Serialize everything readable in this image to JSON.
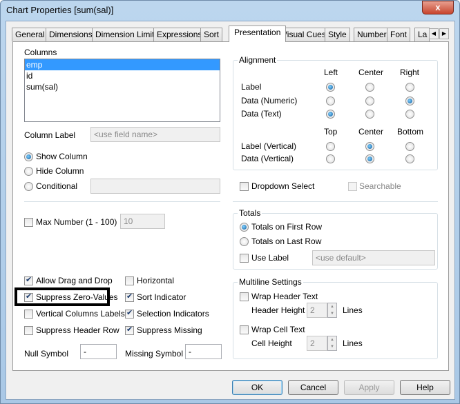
{
  "window": {
    "title": "Chart Properties [sum(sal)]",
    "close": "x"
  },
  "tabs": [
    {
      "label": "General"
    },
    {
      "label": "Dimensions"
    },
    {
      "label": "Dimension Limits"
    },
    {
      "label": "Expressions"
    },
    {
      "label": "Sort"
    },
    {
      "label": "Presentation",
      "selected": true
    },
    {
      "label": "Visual Cues"
    },
    {
      "label": "Style"
    },
    {
      "label": "Number"
    },
    {
      "label": "Font"
    },
    {
      "label": "La"
    }
  ],
  "columns": {
    "caption": "Columns",
    "items": [
      "emp",
      "id",
      "sum(sal)"
    ],
    "selected": "emp",
    "column_label": "Column Label",
    "column_label_placeholder": "<use field name>",
    "show": "Show Column",
    "hide": "Hide Column",
    "conditional": "Conditional",
    "visibility": "show"
  },
  "alignment": {
    "caption": "Alignment",
    "h_headers": [
      "Left",
      "Center",
      "Right"
    ],
    "v_headers": [
      "Top",
      "Center",
      "Bottom"
    ],
    "rows": [
      {
        "label": "Label",
        "value": 0
      },
      {
        "label": "Data (Numeric)",
        "value": 2
      },
      {
        "label": "Data (Text)",
        "value": 0
      }
    ],
    "vrows": [
      {
        "label": "Label (Vertical)",
        "value": 1
      },
      {
        "label": "Data (Vertical)",
        "value": 1
      }
    ]
  },
  "dropdown_select": {
    "label": "Dropdown Select",
    "checked": false
  },
  "searchable": {
    "label": "Searchable",
    "checked": false,
    "disabled": true
  },
  "max_number": {
    "label": "Max Number (1 - 100)",
    "checked": false,
    "value": "10"
  },
  "totals": {
    "caption": "Totals",
    "first": "Totals on First Row",
    "last": "Totals on Last Row",
    "selected": "first",
    "use_label": "Use Label",
    "use_label_checked": false,
    "placeholder": "<use default>"
  },
  "options": [
    {
      "label": "Allow Drag and Drop",
      "checked": true
    },
    {
      "label": "Horizontal",
      "checked": false
    },
    {
      "label": "Suppress Zero-Values",
      "checked": true
    },
    {
      "label": "Sort Indicator",
      "checked": true
    },
    {
      "label": "Vertical Columns Labels",
      "checked": false
    },
    {
      "label": "Selection Indicators",
      "checked": true
    },
    {
      "label": "Suppress Header Row",
      "checked": false
    },
    {
      "label": "Suppress Missing",
      "checked": true
    }
  ],
  "null_symbol": {
    "label": "Null Symbol",
    "value": "-"
  },
  "missing_symbol": {
    "label": "Missing Symbol",
    "value": "-"
  },
  "multiline": {
    "caption": "Multiline Settings",
    "wrap_header": "Wrap Header Text",
    "wrap_header_checked": false,
    "header_height": "Header Height",
    "header_value": "2",
    "wrap_cell": "Wrap Cell Text",
    "wrap_cell_checked": false,
    "cell_height": "Cell Height",
    "cell_value": "2",
    "lines": "Lines"
  },
  "buttons": {
    "ok": "OK",
    "cancel": "Cancel",
    "apply": "Apply",
    "help": "Help"
  }
}
